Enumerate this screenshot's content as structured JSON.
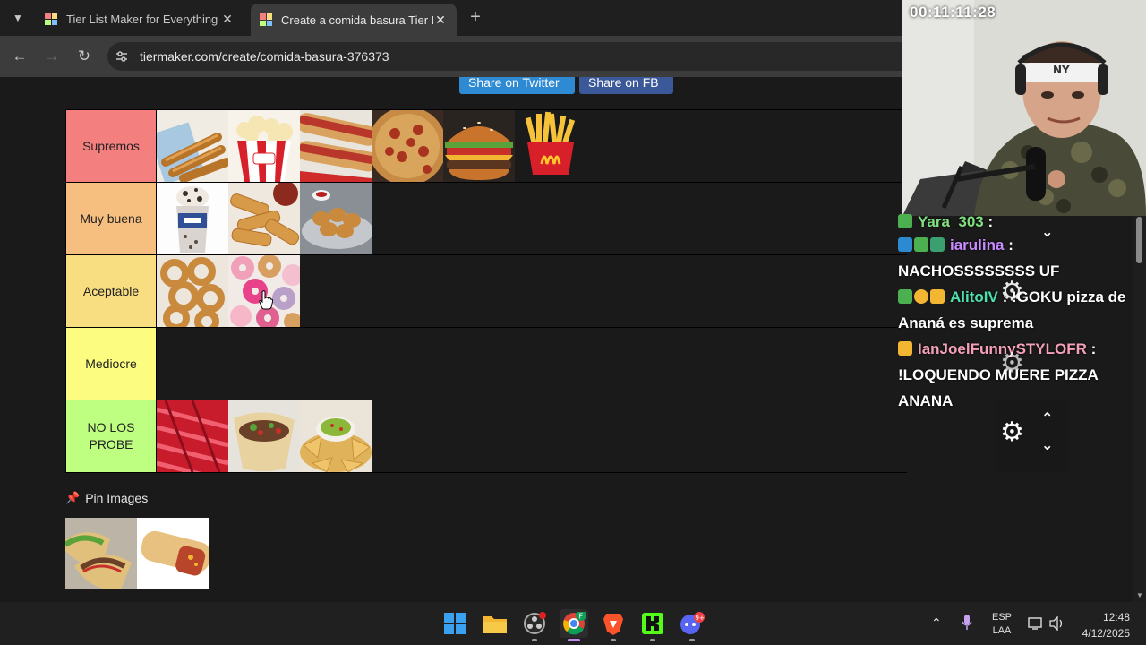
{
  "browser": {
    "tabs": [
      {
        "title": "Tier List Maker for Everything - ",
        "active": false
      },
      {
        "title": "Create a comida basura Tier List",
        "active": true
      }
    ],
    "url": "tiermaker.com/create/comida-basura-376373"
  },
  "page": {
    "share_twitter": "Share on Twitter",
    "share_fb": "Share on FB",
    "tiers": [
      {
        "label": "Supremos",
        "color": "#f37f7f",
        "items": [
          "churros",
          "popcorn",
          "hot-dogs",
          "pizza",
          "cheeseburger",
          "mcdonalds-fries"
        ]
      },
      {
        "label": "Muy buena",
        "color": "#f7bf7f",
        "items": [
          "oreo-milkshake",
          "mozzarella-sticks",
          "chicken-nuggets"
        ]
      },
      {
        "label": "Aceptable",
        "color": "#f8de80",
        "items": [
          "onion-rings",
          "donuts"
        ]
      },
      {
        "label": "Mediocre",
        "color": "#fcfd80",
        "items": []
      },
      {
        "label": "NO LOS PROBE",
        "color": "#befe80",
        "items": [
          "red-licorice",
          "burrito-wrap",
          "nachos-guacamole"
        ]
      }
    ],
    "pin_images_label": "Pin Images",
    "pinned_items": [
      "tacos",
      "crunchwrap-burrito"
    ]
  },
  "stream": {
    "timer": "00:11:11:28",
    "chat": [
      {
        "user": "Yara_303",
        "message": "",
        "user_color": "#7fe07f",
        "partial": true
      },
      {
        "user": "iarulina",
        "message": "NACHOSSSSSSSS UF",
        "user_color": "#c98bff"
      },
      {
        "user": "AlitoIV",
        "message": "!GOKU pizza de Ananá es suprema",
        "user_color": "#4fe0b0"
      },
      {
        "user": "IanJoelFunnySTYLOFR",
        "message": "!LOQUENDO MUERE PIZZA ANANA",
        "user_color": "#f4a0b8"
      }
    ]
  },
  "taskbar": {
    "language": "ESP",
    "layout": "LAA",
    "time": "12:48",
    "date": "4/12/2025",
    "discord_badge": "9+",
    "chrome_badge": "F"
  }
}
